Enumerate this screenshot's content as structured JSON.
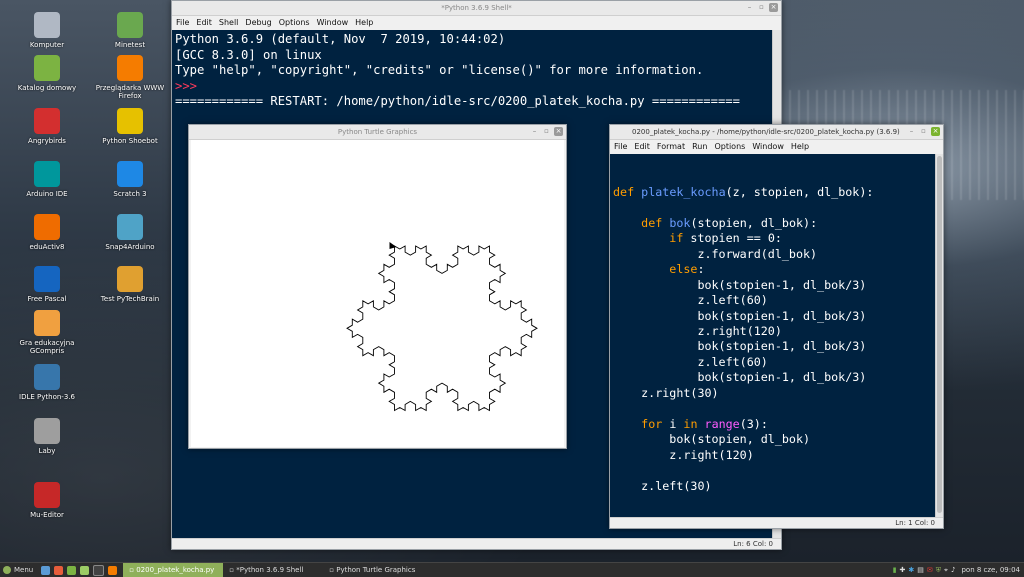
{
  "desktop": {
    "icons": [
      {
        "label": "Komputer",
        "name": "computer-icon",
        "color": "#b0b8c4"
      },
      {
        "label": "Minetest",
        "name": "minetest-icon",
        "color": "#6aa84f"
      },
      {
        "label": "Katalog domowy",
        "name": "home-folder-icon",
        "color": "#7cb342"
      },
      {
        "label": "Przeglądarka WWW Firefox",
        "name": "firefox-icon",
        "color": "#f57c00"
      },
      {
        "label": "Angrybirds",
        "name": "angrybirds-icon",
        "color": "#d32f2f"
      },
      {
        "label": "Python Shoebot",
        "name": "shoebot-icon",
        "color": "#e6c100"
      },
      {
        "label": "Arduino IDE",
        "name": "arduino-icon",
        "color": "#00979c"
      },
      {
        "label": "Scratch 3",
        "name": "scratch-icon",
        "color": "#1e88e5"
      },
      {
        "label": "eduActiv8",
        "name": "eduactiv8-icon",
        "color": "#ef6c00"
      },
      {
        "label": "Snap4Arduino",
        "name": "snap4arduino-icon",
        "color": "#4fa3c7"
      },
      {
        "label": "Free Pascal",
        "name": "freepascal-icon",
        "color": "#1565c0"
      },
      {
        "label": "Test PyTechBrain",
        "name": "pytechbrain-icon",
        "color": "#e0a030"
      },
      {
        "label": "Gra edukacyjna GCompris",
        "name": "gcompris-icon",
        "color": "#f0a040"
      },
      {
        "label": "IDLE Python-3.6",
        "name": "idle-python-icon",
        "color": "#3776ab"
      },
      {
        "label": "Laby",
        "name": "laby-icon",
        "color": "#9e9e9e"
      },
      {
        "label": "Mu-Editor",
        "name": "mu-editor-icon",
        "color": "#c62828"
      }
    ]
  },
  "shell": {
    "title": "*Python 3.6.9 Shell*",
    "menu": [
      "File",
      "Edit",
      "Shell",
      "Debug",
      "Options",
      "Window",
      "Help"
    ],
    "lines": [
      "Python 3.6.9 (default, Nov  7 2019, 10:44:02)",
      "[GCC 8.3.0] on linux",
      "Type \"help\", \"copyright\", \"credits\" or \"license()\" for more information.",
      ">>> ",
      "============ RESTART: /home/python/idle-src/0200_platek_kocha.py ============"
    ],
    "status": "Ln: 6  Col: 0"
  },
  "turtle": {
    "title": "Python Turtle Graphics"
  },
  "editor": {
    "title": "0200_platek_kocha.py - /home/python/idle-src/0200_platek_kocha.py (3.6.9)",
    "menu": [
      "File",
      "Edit",
      "Format",
      "Run",
      "Options",
      "Window",
      "Help"
    ],
    "status": "Ln: 1  Col: 0"
  },
  "taskbar": {
    "menu_label": "Menu",
    "items": [
      {
        "label": "0200_platek_kocha.py",
        "active": true
      },
      {
        "label": "*Python 3.6.9 Shell",
        "active": false
      },
      {
        "label": "Python Turtle Graphics",
        "active": false
      }
    ],
    "clock": "pon  8 cze, 09:04"
  }
}
